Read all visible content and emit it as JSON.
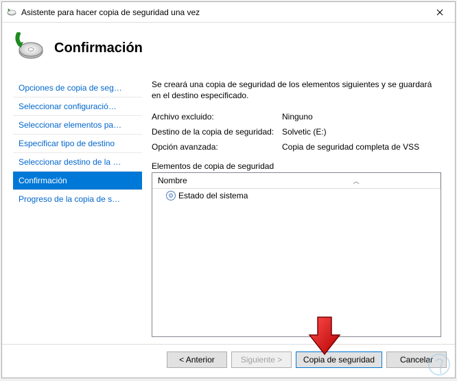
{
  "window": {
    "title": "Asistente para hacer copia de seguridad una vez"
  },
  "header": {
    "title": "Confirmación"
  },
  "sidebar": {
    "items": [
      {
        "label": "Opciones de copia de seg…",
        "active": false
      },
      {
        "label": "Seleccionar configuració…",
        "active": false
      },
      {
        "label": "Seleccionar elementos pa…",
        "active": false
      },
      {
        "label": "Especificar tipo de destino",
        "active": false
      },
      {
        "label": "Seleccionar destino de la …",
        "active": false
      },
      {
        "label": "Confirmación",
        "active": true
      },
      {
        "label": "Progreso de la copia de s…",
        "active": false
      }
    ]
  },
  "main": {
    "description": "Se creará una copia de seguridad de los elementos siguientes y se guardará en el destino especificado.",
    "rows": [
      {
        "label": "Archivo excluido:",
        "value": "Ninguno"
      },
      {
        "label": "Destino de la copia de seguridad:",
        "value": "Solvetic (E:)"
      },
      {
        "label": "Opción avanzada:",
        "value": "Copia de seguridad completa de VSS"
      }
    ],
    "list_label": "Elementos de copia de seguridad",
    "list_header": "Nombre",
    "list_items": [
      {
        "label": "Estado del sistema"
      }
    ]
  },
  "footer": {
    "back": "< Anterior",
    "next": "Siguiente >",
    "action": "Copia de seguridad",
    "cancel": "Cancelar"
  }
}
